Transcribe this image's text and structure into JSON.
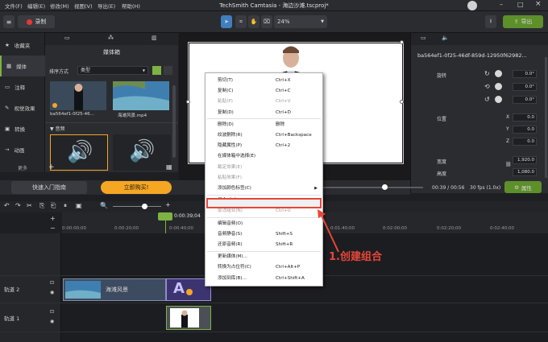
{
  "menu_bar": {
    "items": [
      "文件(F)",
      "编辑(E)",
      "修改(M)",
      "视图(V)",
      "导出(E)",
      "帮助(H)"
    ]
  },
  "app_title": "TechSmith Camtasia - 海边沙滩.tscproj*",
  "toolbar": {
    "record_label": "录制",
    "zoom_value": "24%",
    "export_label": "导出"
  },
  "left_nav": {
    "items": [
      "收藏夹",
      "媒体",
      "注释",
      "视觉效果",
      "转换",
      "动画"
    ],
    "more_label": "更多"
  },
  "media_bin": {
    "title": "媒体箱",
    "sort_label": "排序方式",
    "sort_value": "类型",
    "items": [
      "ba564ef1-0f25-46...",
      "海滩风景.mp4"
    ],
    "audio_section": "音频"
  },
  "properties": {
    "title": "ba564ef1-0f25-46df-859d-12950f62982...",
    "rotation_label": "旋转",
    "rot_z": "0.0°",
    "rot_y": "0.0°",
    "rot_x": "0.0°",
    "position_label": "位置",
    "pos_x": "0.0",
    "pos_y": "0.0",
    "pos_z": "0.0",
    "width_label": "宽度",
    "width_value": "1,920.0",
    "height_label": "高度",
    "height_value": "1,080.0"
  },
  "playback": {
    "time": "00:39 / 00:56",
    "fps": "30 fps (1.0x)",
    "props_button": "属性"
  },
  "promo": {
    "guide_button": "快速入门指南",
    "buy_button": "立即购买!"
  },
  "timeline": {
    "playhead_time": "0:00:39;04",
    "ticks": [
      "0:00:00;00",
      "0:00:20;00",
      "0:00:40;00",
      "0:01:40;00",
      "0:02:00;00",
      "0:02:20;00",
      "0:02:40;00"
    ],
    "tracks": [
      {
        "label": "轨道 2",
        "clip": "海滩风景"
      },
      {
        "label": "轨道 1",
        "clip": ""
      }
    ]
  },
  "context_menu": {
    "items": [
      {
        "label": "剪切(T)",
        "shortcut": "Ctrl+X",
        "disabled": false
      },
      {
        "label": "复制(C)",
        "shortcut": "Ctrl+C",
        "disabled": false
      },
      {
        "label": "粘贴(P)",
        "shortcut": "Ctrl+V",
        "disabled": true
      },
      {
        "label": "复制(D)",
        "shortcut": "Ctrl+D",
        "disabled": false
      },
      {
        "label": "删除(D)",
        "shortcut": "删除",
        "disabled": false
      },
      {
        "label": "纹波删除(R)",
        "shortcut": "Ctrl+Backspace",
        "disabled": false
      },
      {
        "label": "隐藏属性(P)",
        "shortcut": "Ctrl+2",
        "disabled": false
      },
      {
        "label": "在媒体箱中选择(E)",
        "shortcut": "",
        "disabled": false
      },
      {
        "label": "截定效果(E)",
        "shortcut": "",
        "disabled": true
      },
      {
        "label": "粘贴效果(F)",
        "shortcut": "",
        "disabled": true
      },
      {
        "label": "添加颜色标签(C)",
        "shortcut": "",
        "disabled": false
      },
      {
        "label": "组合（G）",
        "shortcut": "Ctrl+G",
        "disabled": false
      },
      {
        "label": "取消组合(N)",
        "shortcut": "Ctrl+U",
        "disabled": true
      },
      {
        "label": "编辑音频(O)",
        "shortcut": "",
        "disabled": false
      },
      {
        "label": "音频静音(S)",
        "shortcut": "Shift+S",
        "disabled": false
      },
      {
        "label": "还原音频(R)",
        "shortcut": "Shift+R",
        "disabled": false
      },
      {
        "label": "更新媒体(M)...",
        "shortcut": "",
        "disabled": false
      },
      {
        "label": "转换为占位符(C)",
        "shortcut": "Ctrl+Alt+P",
        "disabled": false
      },
      {
        "label": "添加到库(B)...",
        "shortcut": "Ctrl+Shift+A",
        "disabled": false
      }
    ]
  },
  "annotation": "1.创建组合",
  "colors": {
    "accent": "#7cb342",
    "highlight": "#e8463a",
    "promo": "#f5a623"
  }
}
